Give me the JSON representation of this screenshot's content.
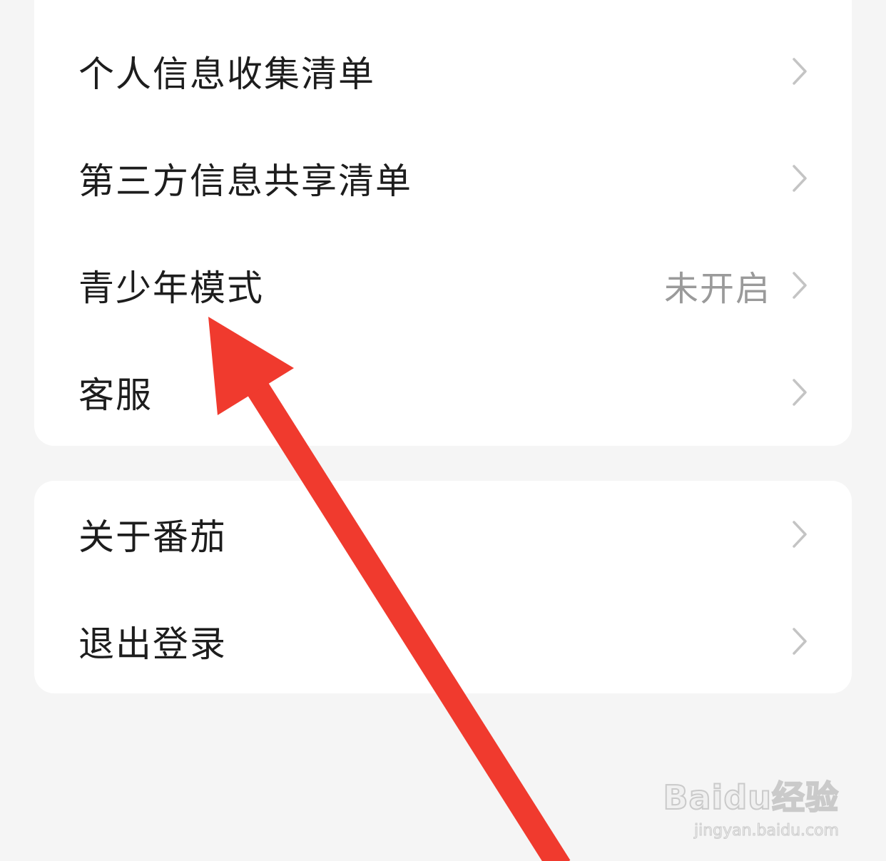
{
  "menu_group_1": {
    "items": [
      {
        "label": "个人信息收集清单",
        "value": ""
      },
      {
        "label": "第三方信息共享清单",
        "value": ""
      },
      {
        "label": "青少年模式",
        "value": "未开启"
      },
      {
        "label": "客服",
        "value": ""
      }
    ]
  },
  "menu_group_2": {
    "items": [
      {
        "label": "关于番茄",
        "value": ""
      },
      {
        "label": "退出登录",
        "value": ""
      }
    ]
  },
  "colors": {
    "background": "#f5f5f5",
    "card": "#ffffff",
    "text": "#1d1d1d",
    "secondary_text": "#9a9a9a",
    "chevron": "#c4c4c4",
    "annotation_arrow": "#f03a2e"
  },
  "watermark": {
    "logo": "Baidu经验",
    "url": "jingyan.baidu.com"
  }
}
